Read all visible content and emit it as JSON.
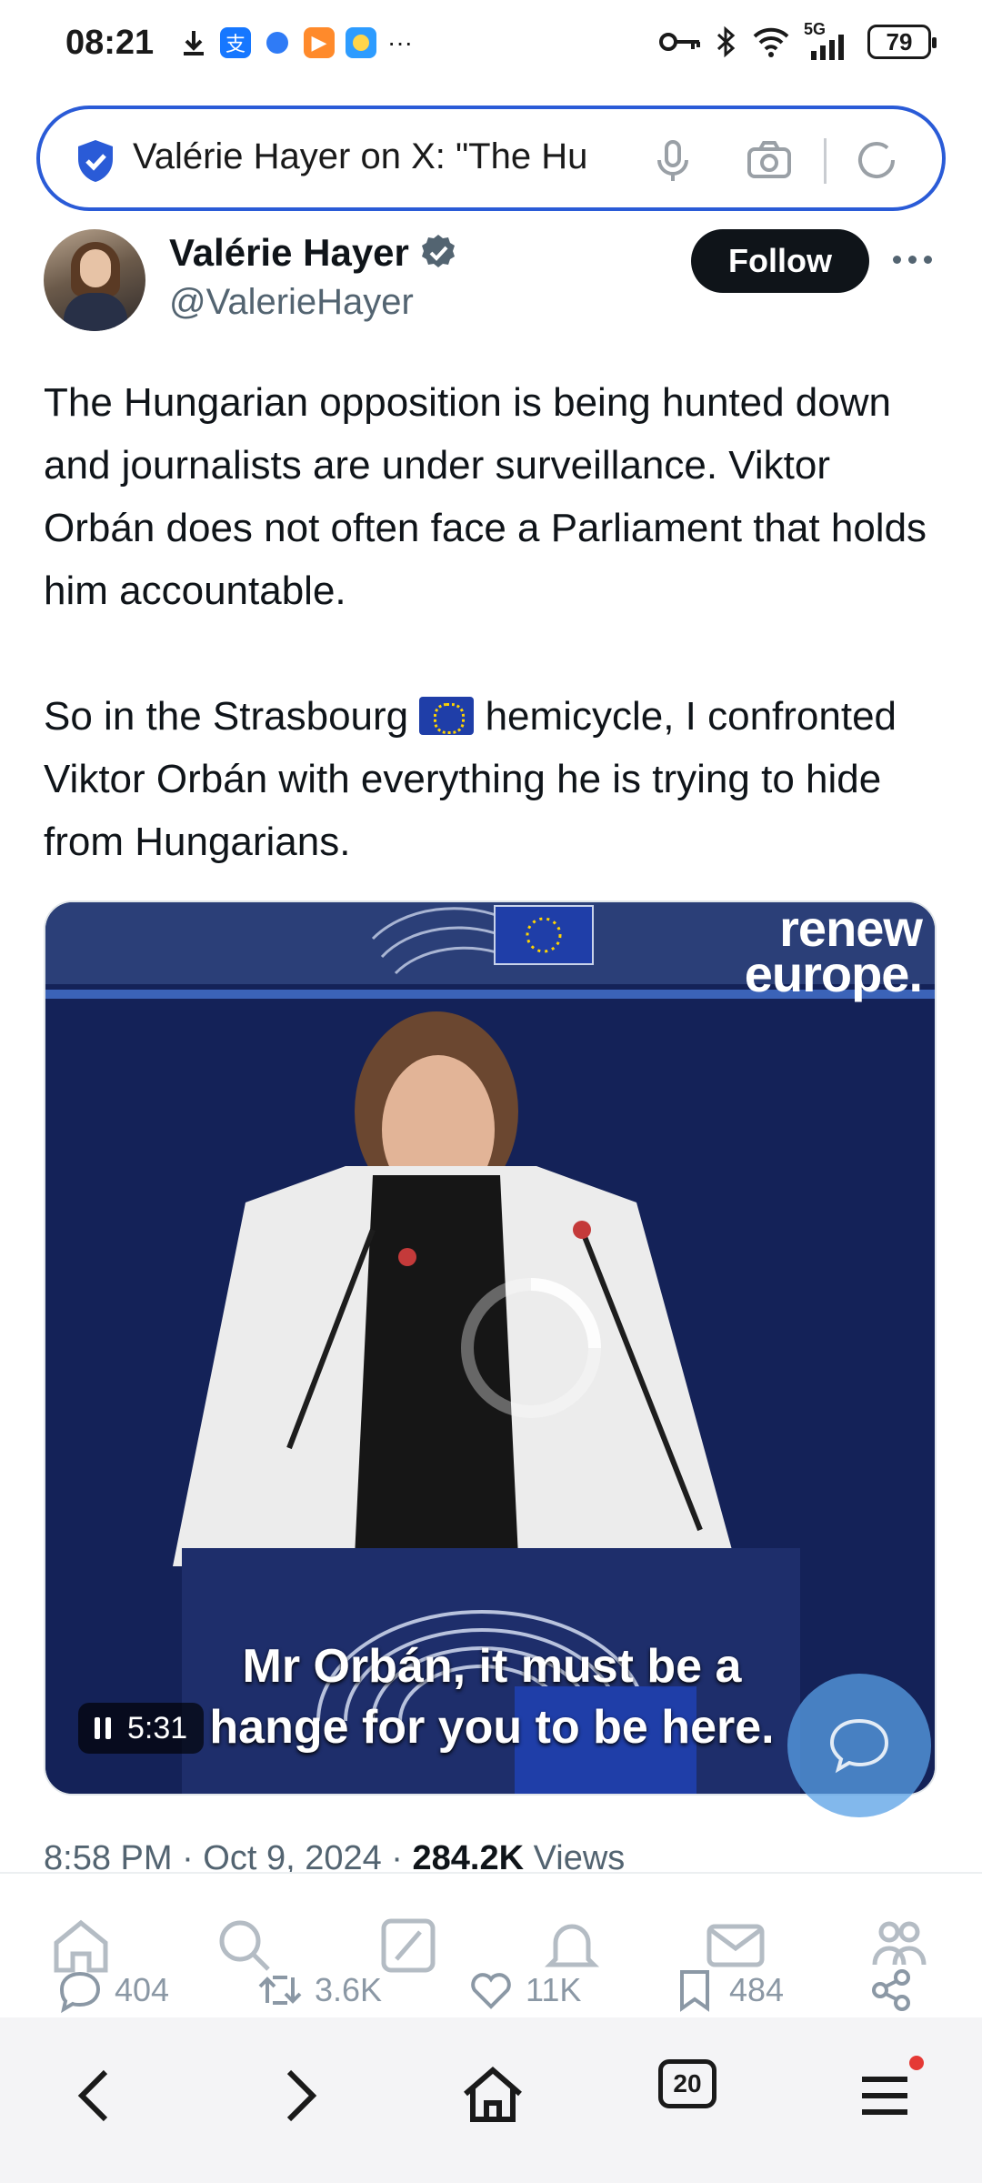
{
  "status_bar": {
    "time": "08:21",
    "more_indicator": "···",
    "network": "5G",
    "battery": "79"
  },
  "address_bar": {
    "url_text": "Valérie Hayer on X: \"The Hu",
    "icons": [
      "shield-check-icon",
      "mic-icon",
      "camera-icon",
      "refresh-icon"
    ]
  },
  "tweet": {
    "author_name": "Valérie Hayer",
    "handle": "@ValerieHayer",
    "follow_label": "Follow",
    "paragraph1": "The Hungarian opposition is being hunted down and journalists are under surveillance. Viktor Orbán does not often face a Parliament that holds him accountable.",
    "paragraph2_before_flag": "So in the Strasbourg ",
    "paragraph2_after_flag": " hemicycle, I confronted Viktor Orbán with everything he is trying to hide from Hungarians.",
    "video": {
      "brand_line1": "renew",
      "brand_line2": "europe.",
      "subtitle_line1": "Mr Orbán, it must be a",
      "subtitle_line2": "hange for you to be here.",
      "timestamp": "5:31"
    },
    "posted_time": "8:58 PM · Oct 9, 2024 · ",
    "views_count": "284.2K",
    "views_label": " Views",
    "replies": "404",
    "reposts": "3.6K",
    "likes": "11K",
    "bookmarks": "484"
  },
  "browser": {
    "tab_count": "20"
  },
  "colors": {
    "accent_blue": "#2a5bd7",
    "x_black": "#0f1419",
    "muted": "#536471",
    "fab_blue": "#58a0e6"
  }
}
